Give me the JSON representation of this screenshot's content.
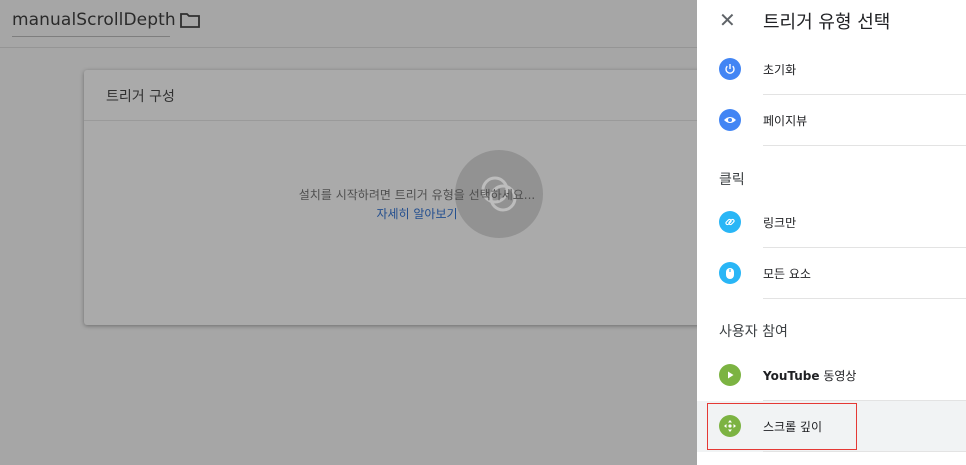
{
  "background": {
    "trigger_name": "manualScrollDepth",
    "card": {
      "title": "트리거 구성",
      "hint": "설치를 시작하려면 트리거 유형을 선택하세요...",
      "link": "자세히 알아보기"
    }
  },
  "panel": {
    "title": "트리거 유형 선택",
    "close_icon": "close-icon",
    "items": [
      {
        "label": "초기화",
        "icon": "power-icon",
        "color": "#4285f4"
      },
      {
        "label": "페이지뷰",
        "icon": "eye-icon",
        "color": "#4285f4"
      },
      {
        "section": "클릭"
      },
      {
        "label": "링크만",
        "icon": "link-icon",
        "color": "#29b6f6"
      },
      {
        "label": "모든 요소",
        "icon": "mouse-icon",
        "color": "#29b6f6"
      },
      {
        "section": "사용자 참여"
      },
      {
        "label_bold": "YouTube",
        "label": " 동영상",
        "icon": "play-icon",
        "color": "#7cb342"
      },
      {
        "label": "스크롤 깊이",
        "icon": "scroll-arrows-icon",
        "color": "#7cb342"
      }
    ]
  },
  "colors": {
    "accent_blue": "#4285f4",
    "light_blue": "#29b6f6",
    "green": "#7cb342",
    "highlight_red": "#e53935"
  }
}
